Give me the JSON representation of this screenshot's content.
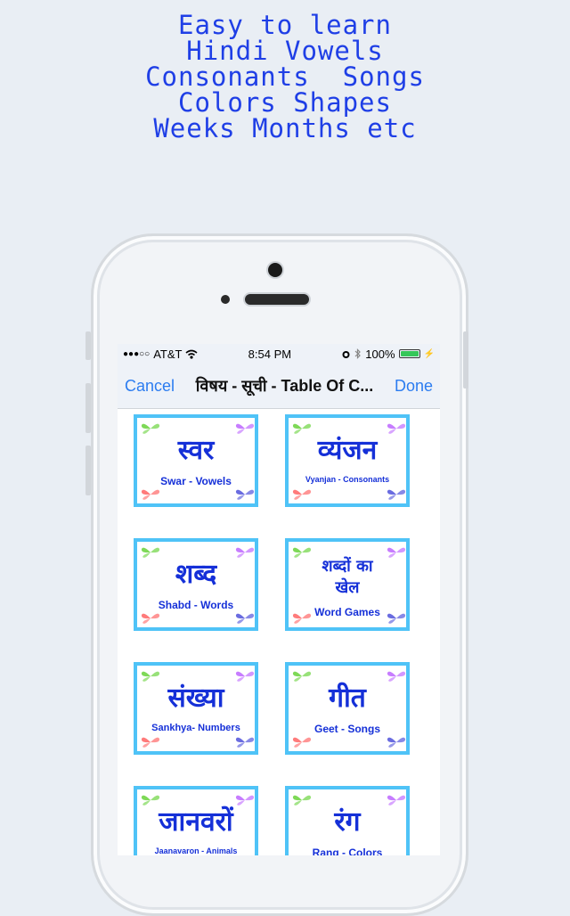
{
  "promo": {
    "lines": [
      "Easy to learn",
      "Hindi Vowels",
      "Consonants  Songs",
      "Colors Shapes",
      "Weeks Months etc"
    ]
  },
  "status_bar": {
    "signal": "●●●○○",
    "carrier": "AT&T",
    "wifi_icon": "wifi-icon",
    "time": "8:54 PM",
    "battery_percent": "100%"
  },
  "nav": {
    "cancel": "Cancel",
    "title": "विषय - सूची - Table Of C...",
    "done": "Done"
  },
  "cards": [
    {
      "hindi": "स्वर",
      "english": "Swar - Vowels"
    },
    {
      "hindi": "व्यंजन",
      "english": "Vyanjan - Consonants"
    },
    {
      "hindi": "शब्द",
      "english": "Shabd - Words"
    },
    {
      "hindi": "शब्दों का खेल",
      "english": "Word Games"
    },
    {
      "hindi": "संख्या",
      "english": "Sankhya- Numbers"
    },
    {
      "hindi": "गीत",
      "english": "Geet - Songs"
    },
    {
      "hindi": "जानवरों",
      "english": "Jaanavaron - Animals"
    },
    {
      "hindi": "रंग",
      "english": "Rang - Colors"
    }
  ],
  "colors": {
    "promo_text": "#1f3fe6",
    "card_border": "#4fc3f7",
    "card_text": "#1530d8",
    "nav_button": "#2b7cf0",
    "battery": "#35c759"
  }
}
